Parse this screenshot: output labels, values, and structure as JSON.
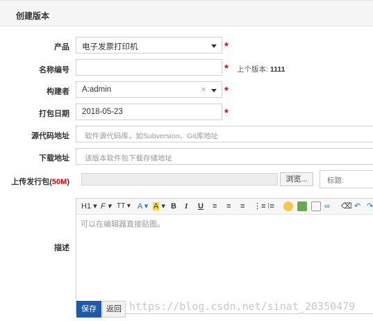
{
  "panel": {
    "title": "创建版本"
  },
  "form": {
    "product": {
      "label": "产品",
      "value": "电子发票打印机"
    },
    "name": {
      "label": "名称编号",
      "value": "",
      "hint_prefix": "上个版本:",
      "hint_value": "1111"
    },
    "builder": {
      "label": "构建者",
      "value": "A:admin",
      "clear": "×"
    },
    "date": {
      "label": "打包日期",
      "value": "2018-05-23"
    },
    "source": {
      "label": "源代码地址",
      "placeholder": "软件源代码库，如Subversion、Git库地址"
    },
    "download": {
      "label": "下载地址",
      "placeholder": "该版本软件包下载存储地址"
    },
    "upload": {
      "label_prefix": "上传发行包(",
      "label_size": "50M",
      "label_suffix": ")",
      "browse": "浏览...",
      "title_placeholder": "标题:"
    },
    "description": {
      "label": "描述",
      "placeholder": "可以在编辑器直接贴图。"
    },
    "required_mark": "*"
  },
  "toolbar": {
    "heading": "H1",
    "font_family": "F",
    "font_size": "TT",
    "font_color": "A",
    "bg_color": "A",
    "bold": "B",
    "italic": "I",
    "underline": "U"
  },
  "actions": {
    "save": "保存",
    "back": "返回"
  },
  "watermark": "https://blog.csdn.net/sinat_20350479",
  "colors": {
    "primary": "#1e5aa8",
    "required": "#e00000"
  }
}
